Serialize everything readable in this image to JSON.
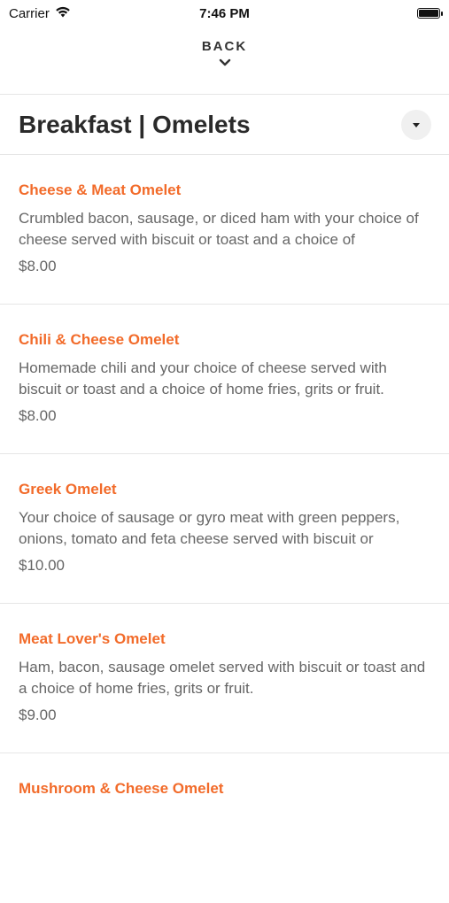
{
  "status_bar": {
    "carrier": "Carrier",
    "time": "7:46 PM"
  },
  "nav": {
    "back_label": "BACK"
  },
  "category": {
    "title": "Breakfast | Omelets"
  },
  "colors": {
    "accent": "#f26b2a",
    "text_muted": "#666666",
    "divider": "#e6e6e6"
  },
  "items": [
    {
      "name": "Cheese & Meat Omelet",
      "description": "Crumbled bacon, sausage, or diced ham with your choice of cheese served with biscuit or toast and a choice of",
      "price": "$8.00"
    },
    {
      "name": "Chili & Cheese Omelet",
      "description": "Homemade chili and your choice of cheese served with biscuit or toast and a choice of home fries, grits or fruit.",
      "price": "$8.00"
    },
    {
      "name": "Greek Omelet",
      "description": "Your choice of sausage or gyro meat with green peppers, onions, tomato and feta cheese served with biscuit or",
      "price": "$10.00"
    },
    {
      "name": "Meat Lover's Omelet",
      "description": "Ham, bacon, sausage omelet served with biscuit or toast and a choice of home fries, grits or fruit.",
      "price": "$9.00"
    },
    {
      "name": "Mushroom & Cheese Omelet",
      "description": "",
      "price": ""
    }
  ]
}
